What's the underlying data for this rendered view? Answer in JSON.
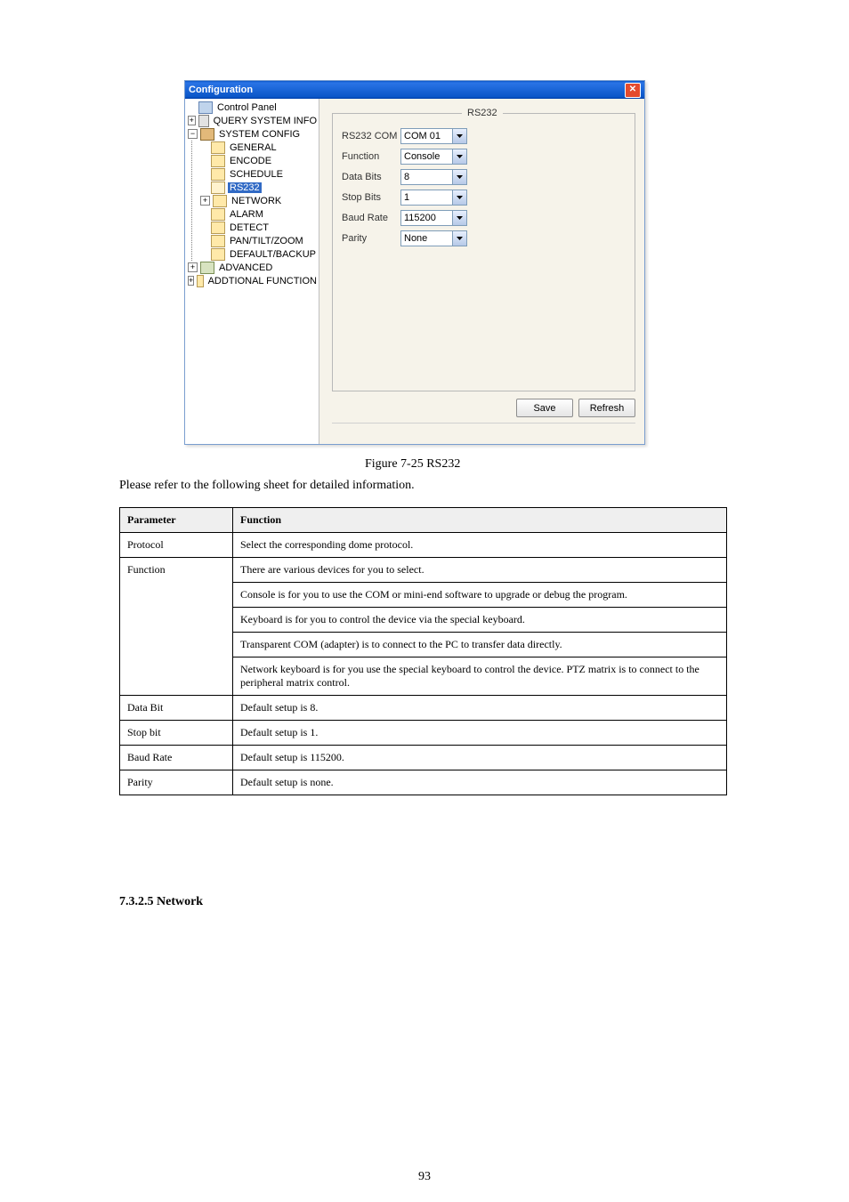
{
  "window": {
    "title": "Configuration",
    "close_tooltip": "Close"
  },
  "tree": {
    "root": {
      "label": "Control Panel"
    },
    "query": {
      "label": "QUERY SYSTEM INFO"
    },
    "sysconfig": {
      "label": "SYSTEM CONFIG"
    },
    "general": {
      "label": "GENERAL"
    },
    "encode": {
      "label": "ENCODE"
    },
    "schedule": {
      "label": "SCHEDULE"
    },
    "rs232": {
      "label": "RS232"
    },
    "network": {
      "label": "NETWORK"
    },
    "alarm": {
      "label": "ALARM"
    },
    "detect": {
      "label": "DETECT"
    },
    "ptz": {
      "label": "PAN/TILT/ZOOM"
    },
    "defaultbackup": {
      "label": "DEFAULT/BACKUP"
    },
    "advanced": {
      "label": "ADVANCED"
    },
    "addtional": {
      "label": "ADDTIONAL FUNCTION"
    }
  },
  "panel": {
    "legend": "RS232",
    "rows": {
      "com": {
        "label": "RS232 COM",
        "value": "COM 01"
      },
      "function": {
        "label": "Function",
        "value": "Console"
      },
      "databits": {
        "label": "Data Bits",
        "value": "8"
      },
      "stopbits": {
        "label": "Stop Bits",
        "value": "1"
      },
      "baudrate": {
        "label": "Baud Rate",
        "value": "115200"
      },
      "parity": {
        "label": "Parity",
        "value": "None"
      }
    },
    "buttons": {
      "save": "Save",
      "refresh": "Refresh"
    }
  },
  "figure_caption": "Figure 7-25 RS232",
  "ref_text": "Please refer to the following sheet for detailed information.",
  "table": {
    "headers": {
      "param": "Parameter",
      "func": "Function"
    },
    "rows": [
      {
        "param": "Protocol",
        "func": "Select the corresponding dome protocol."
      },
      {
        "param": "Function",
        "func_lines": [
          "There are various devices for you to select.",
          "Console is for you to use the COM or mini-end software to upgrade or debug the program.",
          "Keyboard is for you to control the device via the special keyboard.",
          "Transparent COM (adapter) is to connect to the PC to transfer data directly.",
          "Network keyboard is for you use the special keyboard to control the device. PTZ matrix is to connect to the peripheral matrix control."
        ]
      },
      {
        "param": "Data Bit",
        "func": "Default setup is 8."
      },
      {
        "param": "Stop bit",
        "func": "Default setup is 1."
      },
      {
        "param": "Baud Rate",
        "func": "Default setup is 115200."
      },
      {
        "param": "Parity",
        "func": "Default setup is none."
      }
    ]
  },
  "section_heading": "7.3.2.5 Network",
  "page_number": "93"
}
